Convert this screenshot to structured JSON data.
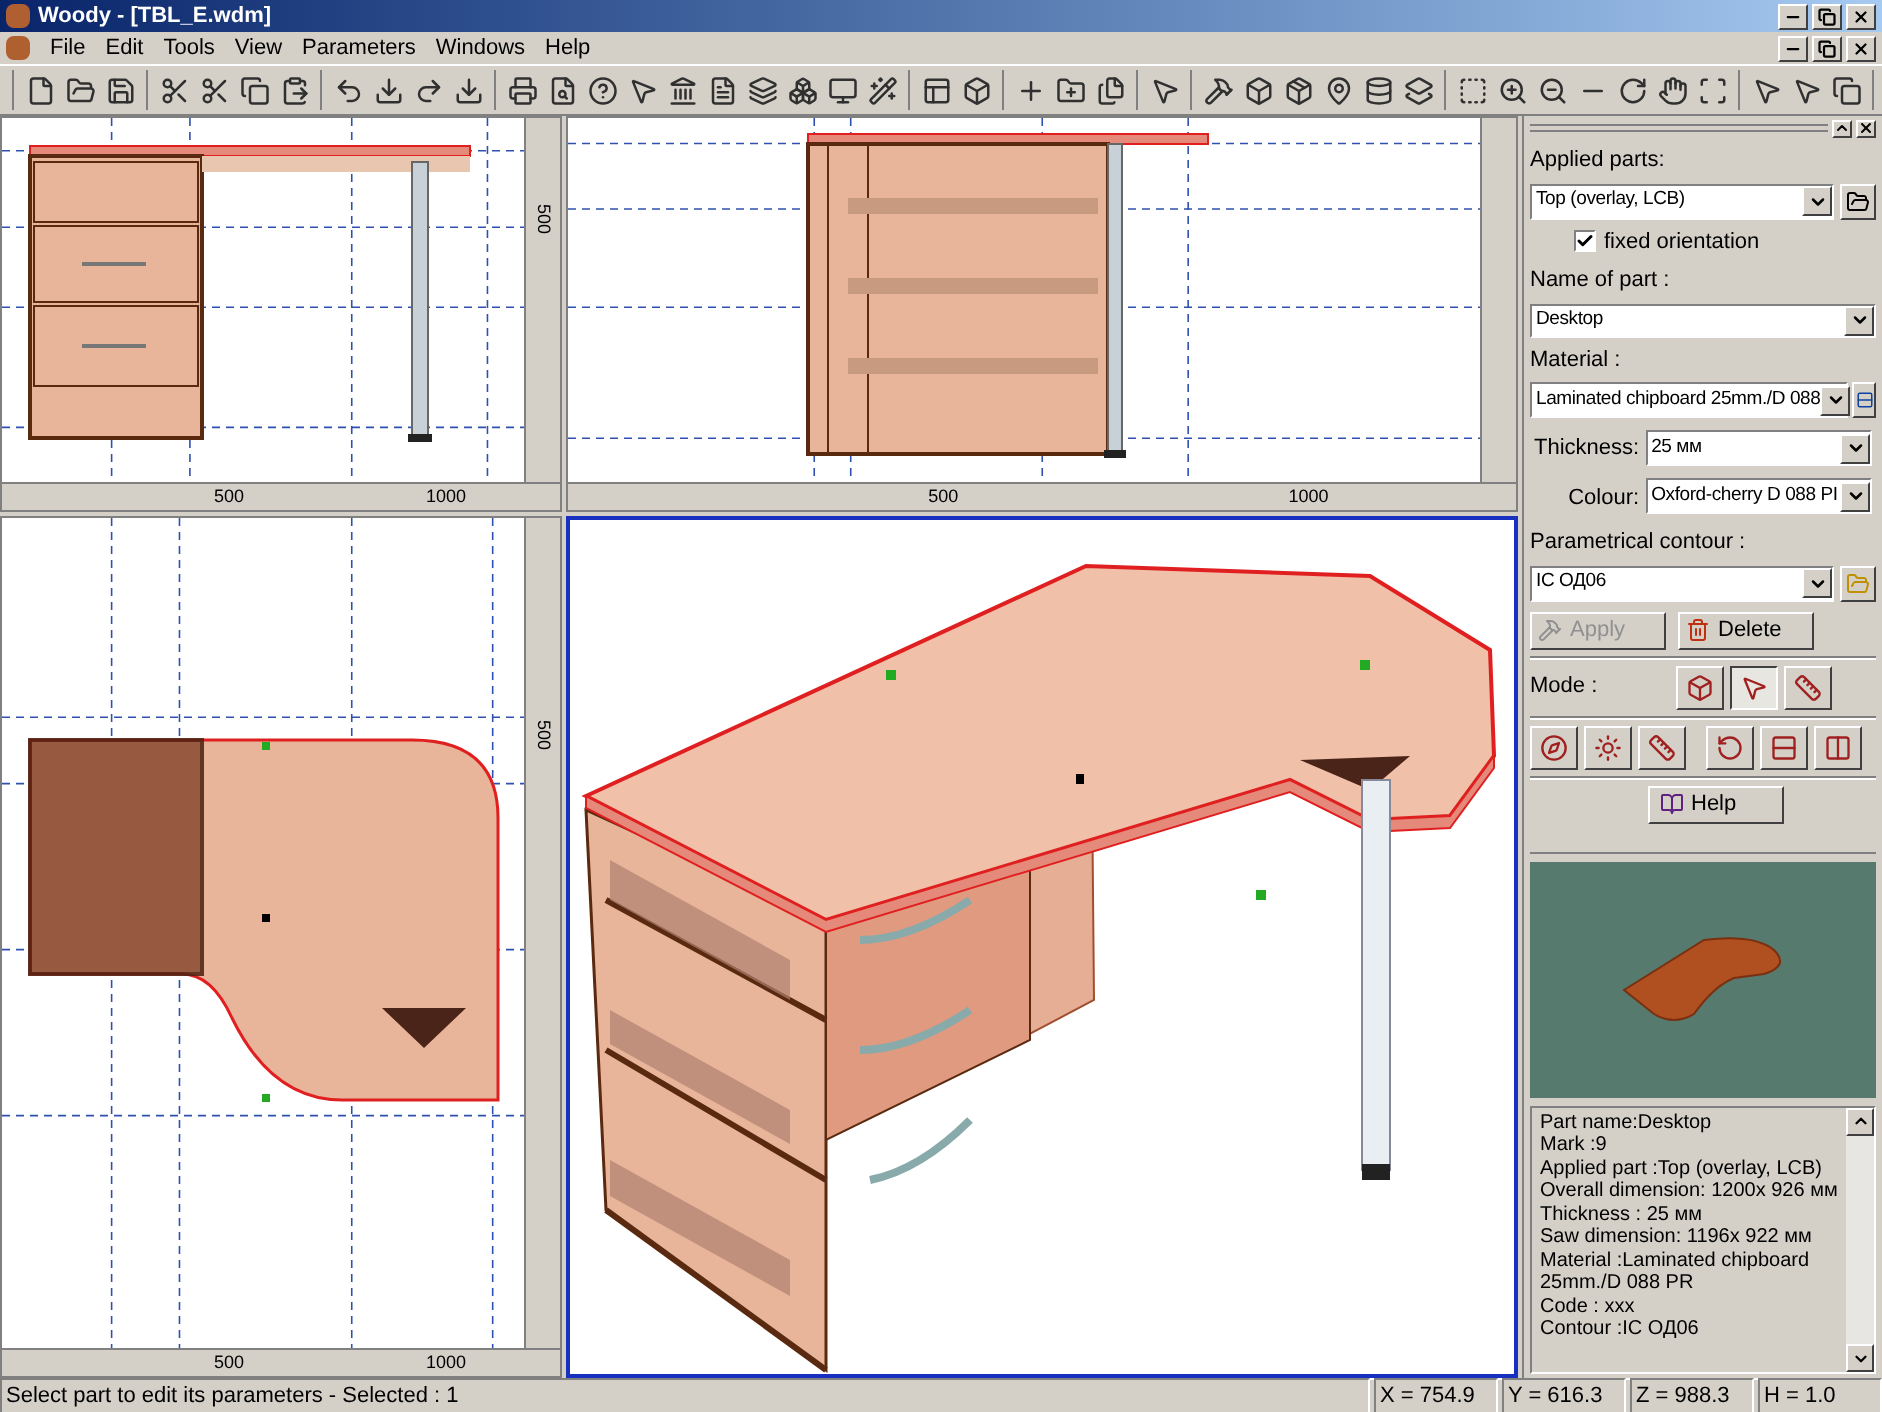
{
  "window": {
    "title": "Woody - [TBL_E.wdm]"
  },
  "menu": [
    {
      "label": "File"
    },
    {
      "label": "Edit"
    },
    {
      "label": "Tools"
    },
    {
      "label": "View"
    },
    {
      "label": "Parameters"
    },
    {
      "label": "Windows"
    },
    {
      "label": "Help"
    }
  ],
  "viewports": [
    {
      "kind": "front",
      "active": false,
      "x_ticks": [
        "500",
        "1000"
      ],
      "y_ticks": [
        "500"
      ]
    },
    {
      "kind": "side",
      "active": false,
      "x_ticks": [
        "500",
        "1000"
      ]
    },
    {
      "kind": "top",
      "active": false,
      "x_ticks": [
        "500",
        "1000"
      ],
      "y_ticks": [
        "500"
      ]
    },
    {
      "kind": "perspective",
      "active": true
    }
  ],
  "panel": {
    "applied_parts": {
      "label": "Applied parts:",
      "value": "Top (overlay, LCB)"
    },
    "fixed_orientation": {
      "label": "fixed orientation",
      "checked": true
    },
    "name_of_part": {
      "label": "Name of part :",
      "value": "Desktop"
    },
    "material": {
      "label": "Material :",
      "value": "Laminated chipboard 25mm./D 088"
    },
    "thickness": {
      "label": "Thickness:",
      "value": "25 мм"
    },
    "colour": {
      "label": "Colour:",
      "value": "Oxford-cherry D 088 PI"
    },
    "contour": {
      "label": "Parametrical contour :",
      "value": "IC ОД06"
    },
    "apply": {
      "label": "Apply",
      "disabled": true
    },
    "delete": {
      "label": "Delete",
      "disabled": false
    },
    "mode": {
      "label": "Mode :",
      "buttons": [
        {
          "selected": false
        },
        {
          "selected": true
        },
        {
          "selected": false
        }
      ]
    },
    "help": {
      "label": "Help"
    },
    "info": [
      "Part name:Desktop",
      "Mark :9",
      "Applied part :Top (overlay, LCB)",
      "Overall dimension: 1200x 926 мм",
      "Thickness : 25 мм",
      "Saw dimension: 1196x 922 мм",
      "Material :Laminated chipboard",
      "25mm./D 088 PR",
      "Code : xxx",
      "Contour :IC ОД06"
    ]
  },
  "status_bar": {
    "message": "Select part to edit its parameters - Selected : 1",
    "x": "X = 754.9",
    "y": "Y = 616.3",
    "z": "Z = 988.3",
    "h": "H = 1.0"
  }
}
